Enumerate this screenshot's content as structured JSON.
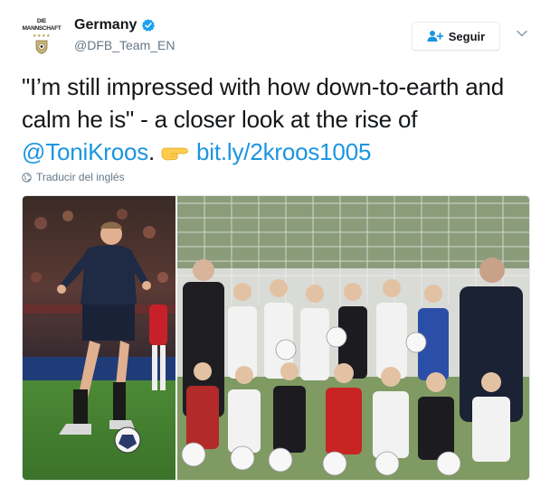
{
  "account": {
    "name": "Germany",
    "handle": "@DFB_Team_EN",
    "avatar_text_top": "DIE",
    "avatar_text_main": "MANNSCHAFT",
    "avatar_stars": "★★★★"
  },
  "follow_button": {
    "label": "Seguir"
  },
  "tweet": {
    "text_main": "\"I’m still impressed with how down-to-earth and calm he is\" - a closer look at the rise of ",
    "mention": "@ToniKroos",
    "after_mention": ".",
    "link": "bit.ly/2kroos1005"
  },
  "translate_label": "Traducir del inglés",
  "colors": {
    "link": "#1b95e0",
    "verified": "#1da1f2",
    "secondary_text": "#657786"
  },
  "icons": [
    "verified-badge-icon",
    "add-user-icon",
    "chevron-down-icon",
    "pointing-hand-emoji-icon",
    "globe-icon"
  ]
}
